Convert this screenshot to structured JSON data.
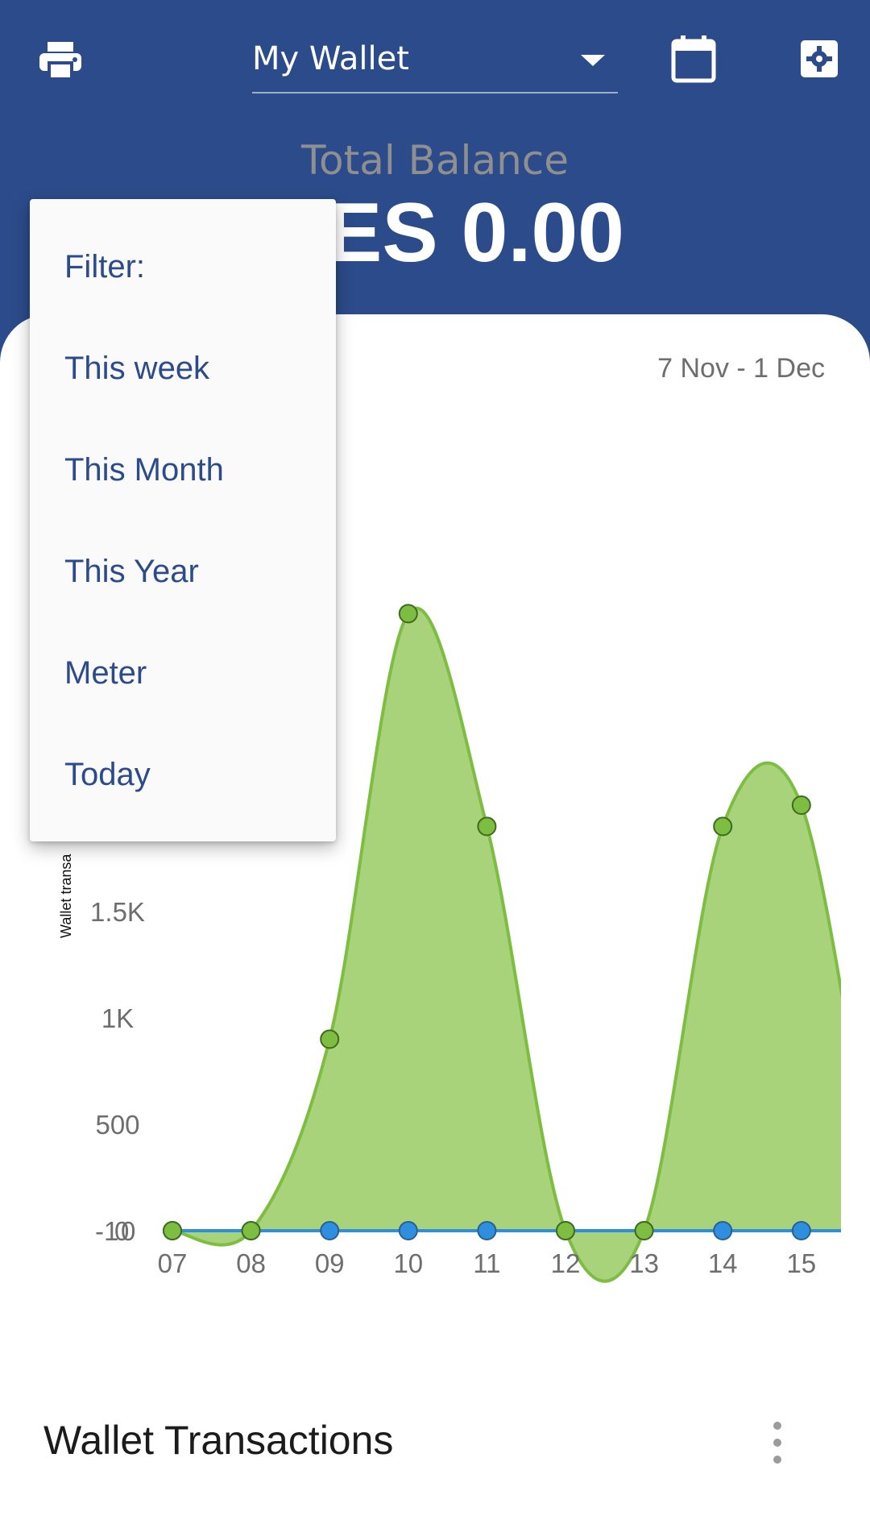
{
  "header": {
    "wallet_name": "My Wallet",
    "balance_label": "Total Balance",
    "balance_value": "ES 0.00",
    "icons": {
      "print": "print-icon",
      "calendar": "calendar-icon",
      "settings": "settings-gear-icon",
      "dropdown": "caret-down-icon"
    }
  },
  "chart_card": {
    "date_range": "7 Nov - 1 Dec"
  },
  "filter_menu": {
    "items": [
      "Filter:",
      "This week",
      "This Month",
      "This Year",
      "Meter",
      "Today"
    ]
  },
  "transactions": {
    "title": "Wallet Transactions",
    "more_icon": "more-vertical-icon"
  },
  "colors": {
    "primary": "#2c4b8a",
    "area_fill": "#a8d37a",
    "area_line": "#7dbd42",
    "point_green": "#7dbd42",
    "point_blue": "#2f8fdf"
  },
  "chart_data": {
    "type": "area",
    "ylabel": "Wallet transa",
    "y_ticks": [
      "500",
      "1K",
      "1.5K"
    ],
    "zero_labels": [
      "-1",
      "0",
      "0"
    ],
    "categories": [
      "07",
      "08",
      "09",
      "10",
      "11",
      "12",
      "13",
      "14",
      "15"
    ],
    "series": [
      {
        "values": [
          0,
          0,
          900,
          2900,
          1900,
          0,
          0,
          1900,
          2000
        ]
      },
      {
        "values": [
          0,
          0,
          0,
          0,
          0,
          0,
          0,
          0,
          0
        ]
      }
    ]
  }
}
